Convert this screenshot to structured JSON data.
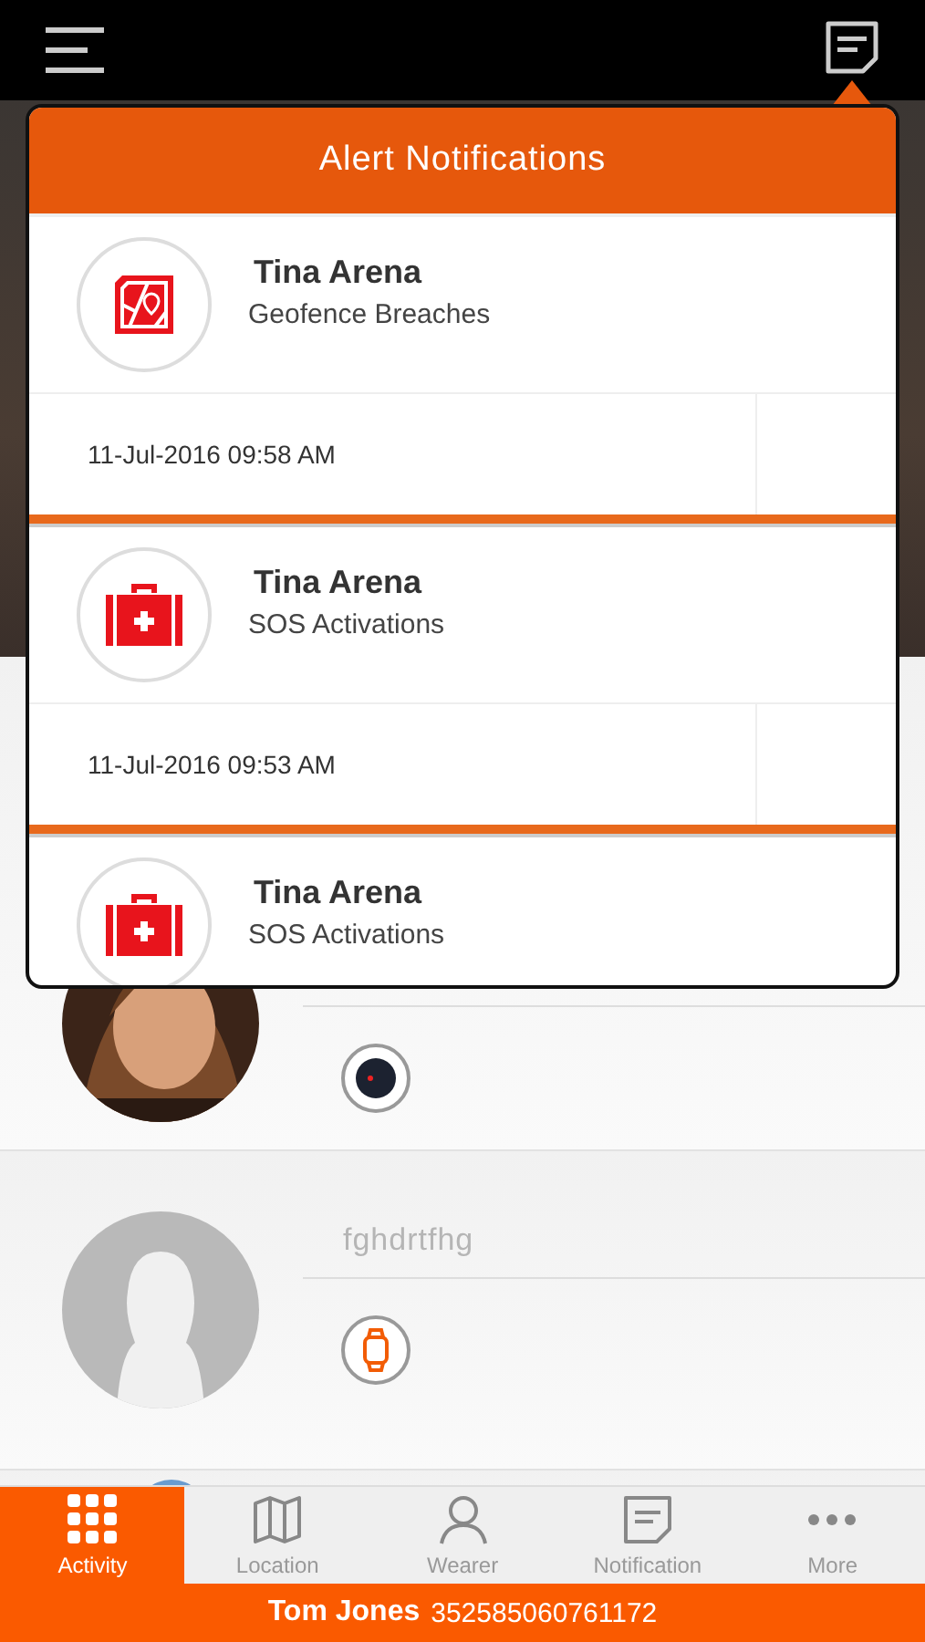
{
  "popup": {
    "title": "Alert Notifications",
    "alerts": [
      {
        "name": "Tina Arena",
        "type": "Geofence Breaches",
        "kind": "geofence",
        "time": "11-Jul-2016 09:58 AM"
      },
      {
        "name": "Tina Arena",
        "type": "SOS Activations",
        "kind": "sos",
        "time": "11-Jul-2016 09:53 AM"
      },
      {
        "name": "Tina Arena",
        "type": "SOS Activations",
        "kind": "sos"
      }
    ]
  },
  "members": [
    {
      "name": "fghdrtfhg"
    }
  ],
  "tabs": [
    {
      "label": "Activity",
      "selected": true
    },
    {
      "label": "Location",
      "selected": false
    },
    {
      "label": "Wearer",
      "selected": false
    },
    {
      "label": "Notification",
      "selected": false
    },
    {
      "label": "More",
      "selected": false
    }
  ],
  "footer": {
    "name": "Tom Jones",
    "number": "352585060761172"
  }
}
